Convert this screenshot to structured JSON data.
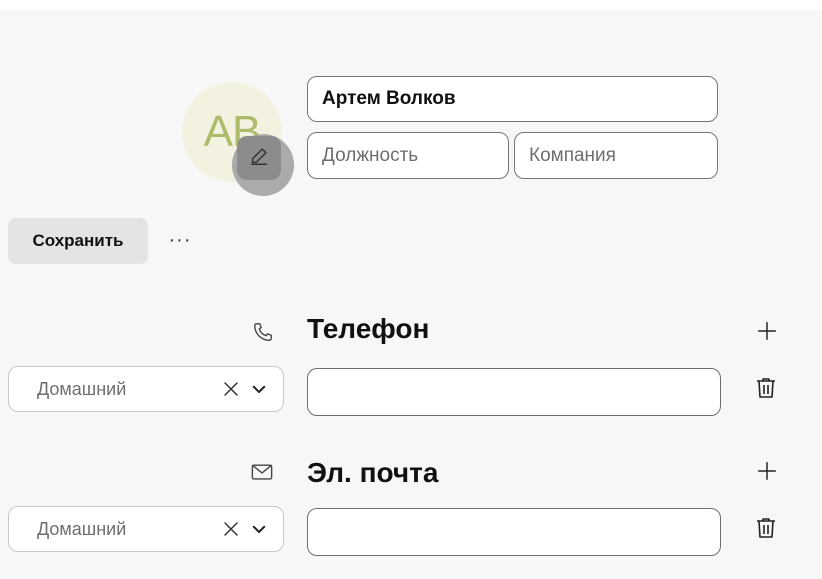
{
  "contact": {
    "initials": "AB",
    "name": "Артем Волков",
    "job_title_placeholder": "Должность",
    "company_placeholder": "Компания"
  },
  "toolbar": {
    "save_label": "Сохранить",
    "more_label": "···"
  },
  "sections": {
    "phone": {
      "title": "Телефон",
      "icon": "phone-icon",
      "type_label": "Домашний",
      "value": ""
    },
    "email": {
      "title": "Эл. почта",
      "icon": "mail-icon",
      "type_label": "Домашний",
      "value": ""
    }
  }
}
